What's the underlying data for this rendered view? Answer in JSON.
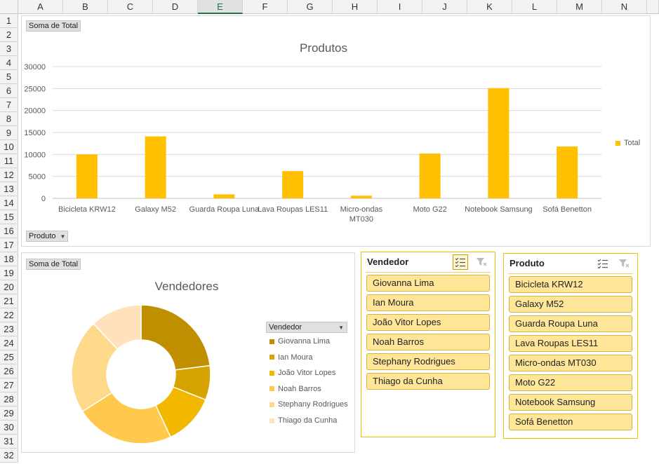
{
  "sheet": {
    "columns": [
      "A",
      "B",
      "C",
      "D",
      "E",
      "F",
      "G",
      "H",
      "I",
      "J",
      "K",
      "L",
      "M",
      "N"
    ],
    "selected_column": "E",
    "rows": [
      "1",
      "2",
      "3",
      "4",
      "5",
      "6",
      "7",
      "8",
      "9",
      "10",
      "11",
      "12",
      "13",
      "14",
      "15",
      "16",
      "17",
      "18",
      "19",
      "20",
      "21",
      "22",
      "23",
      "24",
      "25",
      "26",
      "27",
      "28",
      "29",
      "30",
      "31",
      "32"
    ]
  },
  "produtos_chart": {
    "value_field": "Soma de Total",
    "axis_field": "Produto",
    "title": "Produtos",
    "legend": "Total",
    "color": "#ffc000"
  },
  "vendedores_chart": {
    "value_field": "Soma de Total",
    "title": "Vendedores",
    "legend_field": "Vendedor"
  },
  "chart_data": [
    {
      "type": "bar",
      "title": "Produtos",
      "categories": [
        "Bicicleta KRW12",
        "Galaxy M52",
        "Guarda Roupa Luna",
        "Lava Roupas LES11",
        "Micro-ondas MT030",
        "Moto G22",
        "Notebook Samsung",
        "Sofá Benetton"
      ],
      "category_labels": [
        [
          "Bicicleta KRW12"
        ],
        [
          "Galaxy M52"
        ],
        [
          "Guarda Roupa Luna"
        ],
        [
          "Lava Roupas LES11"
        ],
        [
          "Micro-ondas",
          "MT030"
        ],
        [
          "Moto G22"
        ],
        [
          "Notebook Samsung"
        ],
        [
          "Sofá Benetton"
        ]
      ],
      "series": [
        {
          "name": "Total",
          "values": [
            10000,
            14100,
            900,
            6200,
            600,
            10200,
            25100,
            11800
          ],
          "color": "#ffc000"
        }
      ],
      "yticks": [
        "0",
        "5000",
        "10000",
        "15000",
        "20000",
        "25000",
        "30000"
      ],
      "ylim": [
        0,
        30000
      ],
      "grid": true,
      "legend_position": "right"
    },
    {
      "type": "pie",
      "variant": "donut",
      "title": "Vendedores",
      "categories": [
        "Giovanna Lima",
        "Ian Moura",
        "João Vitor Lopes",
        "Noah Barros",
        "Stephany Rodrigues",
        "Thiago da Cunha"
      ],
      "values": [
        23,
        8,
        12,
        23,
        22,
        12
      ],
      "colors": [
        "#bf8f00",
        "#d6a300",
        "#f2b800",
        "#ffc94d",
        "#ffd98a",
        "#ffe2bb"
      ],
      "legend_position": "right"
    }
  ],
  "slicer_vendedor": {
    "title": "Vendedor",
    "items": [
      "Giovanna Lima",
      "Ian Moura",
      "João Vitor Lopes",
      "Noah Barros",
      "Stephany Rodrigues",
      "Thiago da Cunha"
    ]
  },
  "slicer_produto": {
    "title": "Produto",
    "items": [
      "Bicicleta KRW12",
      "Galaxy M52",
      "Guarda Roupa Luna",
      "Lava Roupas LES11",
      "Micro-ondas MT030",
      "Moto G22",
      "Notebook Samsung",
      "Sofá Benetton"
    ]
  }
}
